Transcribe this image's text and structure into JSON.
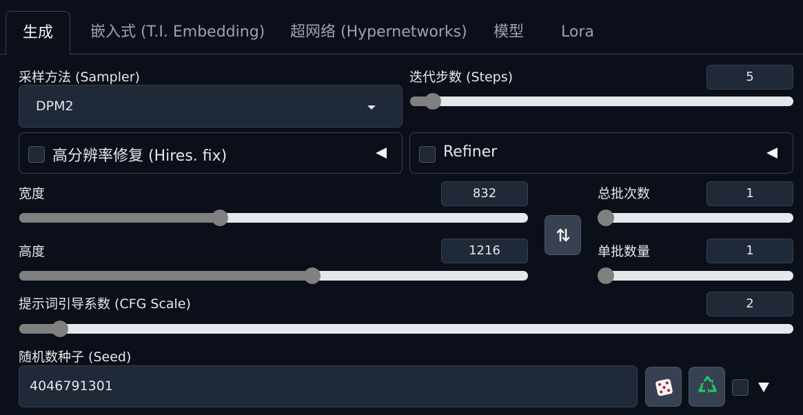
{
  "tabs": [
    {
      "label": "生成",
      "active": true
    },
    {
      "label": "嵌入式 (T.I. Embedding)"
    },
    {
      "label": "超网络 (Hypernetworks)"
    },
    {
      "label": "模型"
    },
    {
      "label": "Lora"
    }
  ],
  "sampler": {
    "label": "采样方法 (Sampler)",
    "value": "DPM2"
  },
  "steps": {
    "label": "迭代步数 (Steps)",
    "value": "5",
    "fraction": 0.04
  },
  "hires": {
    "label": "高分辨率修复 (Hires. fix)",
    "checked": false
  },
  "refiner": {
    "label": "Refiner",
    "checked": false
  },
  "width": {
    "label": "宽度",
    "value": "832",
    "fraction": 0.391
  },
  "height": {
    "label": "高度",
    "value": "1216",
    "fraction": 0.579
  },
  "batch_count": {
    "label": "总批次数",
    "value": "1",
    "fraction": 0.0
  },
  "batch_size": {
    "label": "单批数量",
    "value": "1",
    "fraction": 0.0
  },
  "cfg": {
    "label": "提示词引导系数 (CFG Scale)",
    "value": "2",
    "fraction": 0.043
  },
  "seed": {
    "label": "随机数种子 (Seed)",
    "value": "4046791301"
  },
  "icons": {
    "swap": "swap-dimensions-icon",
    "dice": "dice-icon",
    "recycle": "recycle-icon"
  },
  "colors": {
    "background": "#0b0f19",
    "input": "#1f2937",
    "border": "#374151",
    "slider_fill": "#808080",
    "recycle": "#22c55e"
  }
}
